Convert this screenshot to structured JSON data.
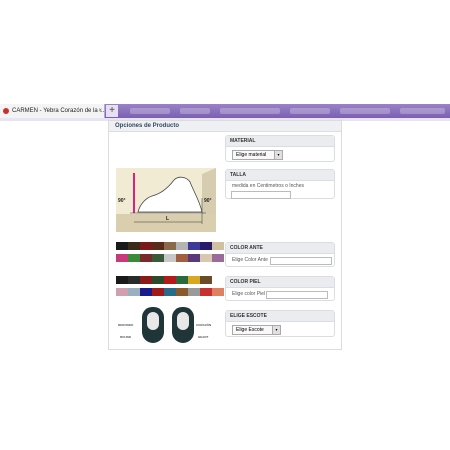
{
  "browser": {
    "tab_title": "CARMEN - Yebra Corazón de la ...",
    "tab_close": "×",
    "new_tab": "+"
  },
  "panel": {
    "title": "Opciones de Producto"
  },
  "sections": {
    "material": {
      "title": "MATERIAL",
      "select_value": "Elige material"
    },
    "talla": {
      "title": "TALLA",
      "hint": "medida en Centimetros o Inches"
    },
    "color_ante": {
      "title": "COLOR ANTE",
      "label": "Elige Color Ante"
    },
    "color_piel": {
      "title": "COLOR PIEL",
      "label": "Elige color Piel"
    },
    "escote": {
      "title": "ELIGE ESCOTE",
      "select_value": "Elige Escote"
    }
  },
  "foot_diagram": {
    "angle_left": "90°",
    "angle_right": "90°",
    "length_label": "L"
  },
  "shoe_labels": {
    "top_left": "REDONDO",
    "top_right": "CORAZÓN",
    "bottom_left": "ROUND",
    "bottom_right": "HEART"
  },
  "swatches": {
    "ante_row1": [
      "#1a1a1a",
      "#3a2a1a",
      "#7a1a1a",
      "#5a2a1a",
      "#8a6a4a",
      "#b4b4b4",
      "#3a3a9a",
      "#2a1a6a",
      "#d0c0a0"
    ],
    "ante_row2": [
      "#c83a7a",
      "#3a8a3a",
      "#7a2a2a",
      "#3a5a3a",
      "#c8c8c8",
      "#a06040",
      "#5a3a7a",
      "#d8c8b0",
      "#9a6a9a"
    ],
    "piel_row1": [
      "#1a1a1a",
      "#2a2a2a",
      "#8a1a1a",
      "#2a4a2a",
      "#b41a1a",
      "#2a6a3a",
      "#d8a820",
      "#6a4a2a",
      "#ffffff"
    ],
    "piel_row2": [
      "#d0a0b0",
      "#9ab0c0",
      "#1a1a8a",
      "#a01a1a",
      "#2a6a8a",
      "#8a5a2a",
      "#9a9a9a",
      "#c83030",
      "#e08060"
    ]
  },
  "icons": {
    "arrow_down": "▾"
  }
}
